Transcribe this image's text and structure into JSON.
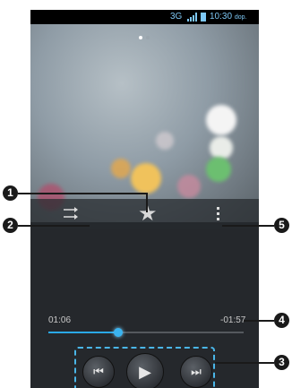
{
  "status_bar": {
    "network": "3G",
    "time": "10:30",
    "time_suffix": "dop."
  },
  "player": {
    "elapsed": "01:06",
    "remaining": "-01:57",
    "progress_fraction": 0.36
  },
  "callouts": [
    "1",
    "2",
    "3",
    "4",
    "5"
  ],
  "colors": {
    "accent": "#3ab4f0",
    "dash": "#4ab6e8"
  },
  "icons": {
    "favorite": "star-icon",
    "shuffle": "shuffle-icon",
    "menu": "menu-icon",
    "previous": "previous-icon",
    "play": "play-icon",
    "next": "next-icon"
  }
}
